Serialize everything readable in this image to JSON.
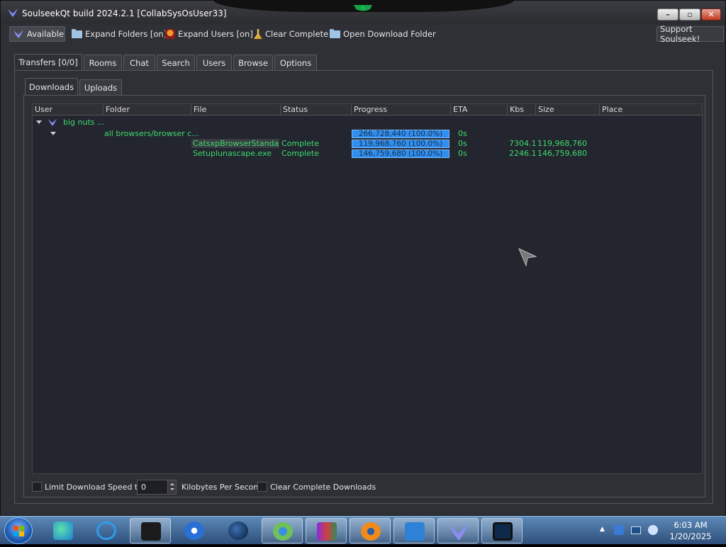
{
  "window": {
    "title": "SoulseekQt build 2024.2.1 [CollabSysOsUser33]"
  },
  "toolbar": {
    "available": "Available",
    "expand_folders": "Expand Folders [on]",
    "expand_users": "Expand Users [on]",
    "clear_complete": "Clear Complete",
    "open_download_folder": "Open Download Folder",
    "support": "Support Soulseek!"
  },
  "tabs": [
    "Transfers [0/0]",
    "Rooms",
    "Chat",
    "Search",
    "Users",
    "Browse",
    "Options"
  ],
  "subtabs": [
    "Downloads",
    "Uploads"
  ],
  "columns": [
    "User",
    "Folder",
    "File",
    "Status",
    "Progress",
    "ETA",
    "Kbs",
    "Size",
    "Place"
  ],
  "tree": {
    "user": "big nuts ...",
    "folder": "all browsers/browser c...",
    "folder_progress": "266,728,440 (100.0%)",
    "folder_eta": "0s",
    "files": [
      {
        "file": "CatsxpBrowserStandal...",
        "status": "Complete",
        "progress": "119,968,760 (100.0%)",
        "progress_fraction": 1.0,
        "eta": "0s",
        "kbs": "7304.1",
        "size": "119,968,760"
      },
      {
        "file": "Setuplunascape.exe",
        "status": "Complete",
        "progress": "146,759,680 (100.0%)",
        "progress_fraction": 1.0,
        "eta": "0s",
        "kbs": "2246.1",
        "size": "146,759,680"
      }
    ]
  },
  "bottom": {
    "limit_label": "Limit Download Speed to",
    "speed_value": "0",
    "unit_label": "Kilobytes Per Second",
    "clear_label": "Clear Complete Downloads"
  },
  "clock": {
    "time": "6:03 AM",
    "date": "1/20/2025"
  },
  "colors": {
    "accent": "#2f8ff0",
    "text_green": "#3ddc6a",
    "background": "#2f3035"
  }
}
